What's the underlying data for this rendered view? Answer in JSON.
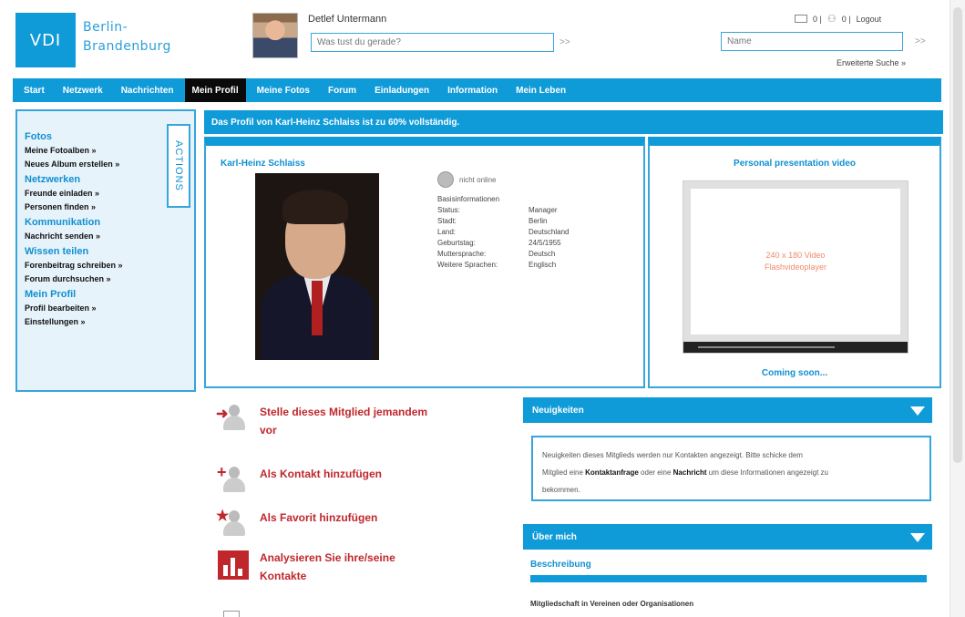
{
  "header": {
    "logo": "VDI",
    "region_line1": "Berlin-",
    "region_line2": "Brandenburg",
    "user_name": "Detlef Untermann",
    "status_placeholder": "Was tust du gerade?",
    "status_go": ">>",
    "mail_count": "0 |",
    "friends_count": "0 |",
    "logout": "Logout",
    "search_placeholder": "Name",
    "search_go": ">>",
    "advanced_search": "Erweiterte Suche »"
  },
  "nav": {
    "items": [
      "Start",
      "Netzwerk",
      "Nachrichten",
      "Mein Profil",
      "Meine Fotos",
      "Forum",
      "Einladungen",
      "Information",
      "Mein Leben"
    ],
    "active": "Mein Profil"
  },
  "sidebar": {
    "actions_tab": "ACTIONS",
    "groups": [
      {
        "title": "Fotos",
        "links": [
          "Meine Fotoalben »",
          "Neues Album erstellen »"
        ]
      },
      {
        "title": "Netzwerken",
        "links": [
          "Freunde einladen »",
          "Personen finden »"
        ]
      },
      {
        "title": "Kommunikation",
        "links": [
          "Nachricht senden »"
        ]
      },
      {
        "title": "Wissen teilen",
        "links": [
          "Forenbeitrag schreiben »",
          "Forum durchsuchen »"
        ]
      },
      {
        "title": "Mein Profil",
        "links": [
          "Profil bearbeiten »",
          "Einstellungen »"
        ]
      }
    ]
  },
  "banner": "Das Profil von Karl-Heinz Schlaiss ist zu 60% vollständig.",
  "profile": {
    "name": "Karl-Heinz Schlaiss",
    "online_status": "nicht online",
    "info_title": "Basisinformationen",
    "rows": [
      {
        "k": "Status:",
        "v": "Manager"
      },
      {
        "k": "Stadt:",
        "v": "Berlin"
      },
      {
        "k": "Land:",
        "v": "Deutschland"
      },
      {
        "k": "Geburtstag:",
        "v": "24/5/1955"
      },
      {
        "k": "Muttersprache:",
        "v": "Deutsch"
      },
      {
        "k": "Weitere Sprachen:",
        "v": "Englisch"
      }
    ]
  },
  "video": {
    "title": "Personal presentation video",
    "placeholder_line1": "240 x 180 Video",
    "placeholder_line2": "Flashvideoplayer",
    "coming_soon": "Coming soon..."
  },
  "actions": [
    {
      "label_line1": "Stelle dieses Mitglied jemandem",
      "label_line2": "vor",
      "icon": "arrow-person-icon"
    },
    {
      "label_line1": "Als Kontakt hinzufügen",
      "label_line2": "",
      "icon": "plus-person-icon"
    },
    {
      "label_line1": "Als Favorit hinzufügen",
      "label_line2": "",
      "icon": "star-person-icon"
    },
    {
      "label_line1": "Analysieren Sie ihre/seine",
      "label_line2": "Kontakte",
      "icon": "bar-chart-icon"
    }
  ],
  "news": {
    "title": "Neuigkeiten",
    "text_1": "Neuigkeiten dieses Mitglieds werden nur Kontakten angezeigt. Bitte schicke dem",
    "text_2": "Mitglied eine ",
    "link_1": "Kontaktanfrage",
    "text_3": " oder eine ",
    "link_2": "Nachricht",
    "text_4": " um diese Informationen angezeigt zu",
    "text_5": "bekommen."
  },
  "about": {
    "title": "Über mich",
    "description_title": "Beschreibung",
    "membership_label": "Mitgliedschaft in Vereinen oder Organisationen"
  },
  "colors": {
    "primary": "#0f9ad8",
    "accent_red": "#c0272d",
    "sidebar_bg": "#e7f3fb"
  }
}
